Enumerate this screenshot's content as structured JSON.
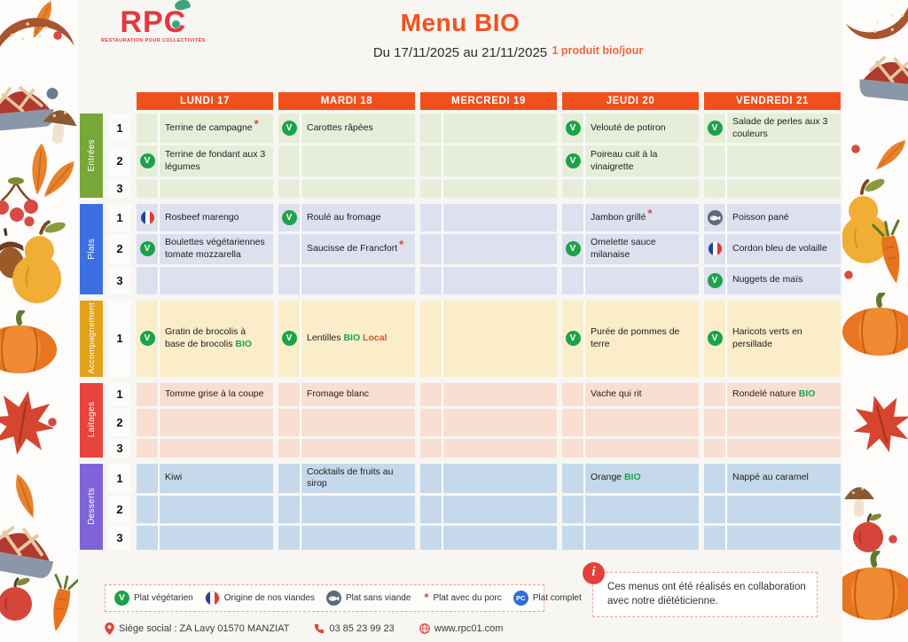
{
  "header": {
    "logo_text": "RPC",
    "logo_tagline": "RESTAURATION POUR COLLECTIVITÉS",
    "title": "Menu BIO",
    "date_range": "Du 17/11/2025 au 21/11/2025",
    "bio_note": "1 produit bio/jour"
  },
  "days": [
    "LUNDI 17",
    "MARDI 18",
    "MERCREDI 19",
    "JEUDI 20",
    "VENDREDI 21"
  ],
  "colors": {
    "day_header_orange": "#F1501D",
    "logo_red": "#E5383E",
    "bio_green": "#17A74F",
    "local_orange": "#C75A2B",
    "asterisk_red": "#E3403A"
  },
  "sections": [
    {
      "label": "Entrées",
      "label_color": "#76A737",
      "cell_color": "#E6EEDA",
      "rows": [
        {
          "num": "1",
          "cells": [
            {
              "icon": null,
              "asterisk": true,
              "segments": [
                [
                  "Terrine de campagne",
                  "plain"
                ]
              ]
            },
            {
              "icon": "veg",
              "segments": [
                [
                  "Carottes râpées",
                  "plain"
                ]
              ]
            },
            {
              "icon": null,
              "segments": []
            },
            {
              "icon": "veg",
              "segments": [
                [
                  "Velouté de potiron",
                  "plain"
                ]
              ]
            },
            {
              "icon": "veg",
              "segments": [
                [
                  "Salade de perles aux 3 couleurs",
                  "plain"
                ]
              ]
            }
          ]
        },
        {
          "num": "2",
          "cells": [
            {
              "icon": "veg",
              "segments": [
                [
                  "Terrine de fondant aux 3 légumes",
                  "plain"
                ]
              ]
            },
            {
              "icon": null,
              "segments": []
            },
            {
              "icon": null,
              "segments": []
            },
            {
              "icon": "veg",
              "segments": [
                [
                  "Poireau cuit à la vinaigrette",
                  "plain"
                ]
              ]
            },
            {
              "icon": null,
              "segments": []
            }
          ]
        },
        {
          "num": "3",
          "cells": [
            {
              "icon": null,
              "segments": []
            },
            {
              "icon": null,
              "segments": []
            },
            {
              "icon": null,
              "segments": []
            },
            {
              "icon": null,
              "segments": []
            },
            {
              "icon": null,
              "segments": []
            }
          ]
        }
      ]
    },
    {
      "label": "Plats",
      "label_color": "#3C70E2",
      "cell_color": "#DCE0EF",
      "rows": [
        {
          "num": "1",
          "cells": [
            {
              "icon": "flag",
              "segments": [
                [
                  "Rosbeef marengo",
                  "plain"
                ]
              ]
            },
            {
              "icon": "veg",
              "segments": [
                [
                  "Roulé au fromage",
                  "plain"
                ]
              ]
            },
            {
              "icon": null,
              "segments": []
            },
            {
              "icon": null,
              "asterisk": true,
              "segments": [
                [
                  "Jambon grillé",
                  "plain"
                ]
              ]
            },
            {
              "icon": "fish",
              "segments": [
                [
                  "Poisson pané",
                  "plain"
                ]
              ]
            }
          ]
        },
        {
          "num": "2",
          "cells": [
            {
              "icon": "veg",
              "segments": [
                [
                  "Boulettes végétariennes tomate mozzarella",
                  "plain"
                ]
              ]
            },
            {
              "icon": null,
              "asterisk": true,
              "segments": [
                [
                  "Saucisse de Francfort",
                  "plain"
                ]
              ]
            },
            {
              "icon": null,
              "segments": []
            },
            {
              "icon": "veg",
              "segments": [
                [
                  "Omelette sauce milanaise",
                  "plain"
                ]
              ]
            },
            {
              "icon": "flag",
              "segments": [
                [
                  "Cordon bleu de volaille",
                  "plain"
                ]
              ]
            }
          ]
        },
        {
          "num": "3",
          "cells": [
            {
              "icon": null,
              "segments": []
            },
            {
              "icon": null,
              "segments": []
            },
            {
              "icon": null,
              "segments": []
            },
            {
              "icon": null,
              "segments": []
            },
            {
              "icon": "veg",
              "segments": [
                [
                  "Nuggets de maïs",
                  "plain"
                ]
              ]
            }
          ]
        }
      ]
    },
    {
      "label": "Accompagnement",
      "label_color": "#E2A21A",
      "cell_color": "#FBEDCA",
      "rows": [
        {
          "num": "1",
          "cells": [
            {
              "icon": "veg",
              "segments": [
                [
                  "Gratin de brocolis à base de brocolis ",
                  "plain"
                ],
                [
                  "BIO",
                  "bio"
                ]
              ]
            },
            {
              "icon": "veg",
              "segments": [
                [
                  "Lentilles ",
                  "plain"
                ],
                [
                  "BIO",
                  "bio"
                ],
                [
                  " ",
                  "plain"
                ],
                [
                  "Local",
                  "local"
                ]
              ]
            },
            {
              "icon": null,
              "segments": []
            },
            {
              "icon": "veg",
              "segments": [
                [
                  "Purée de pommes de terre",
                  "plain"
                ]
              ]
            },
            {
              "icon": "veg",
              "segments": [
                [
                  "Haricots verts en persillade",
                  "plain"
                ]
              ]
            }
          ]
        }
      ]
    },
    {
      "label": "Laitages",
      "label_color": "#E8443C",
      "cell_color": "#F9DFD2",
      "rows": [
        {
          "num": "1",
          "cells": [
            {
              "icon": null,
              "segments": [
                [
                  "Tomme grise à la coupe",
                  "plain"
                ]
              ]
            },
            {
              "icon": null,
              "segments": [
                [
                  "Fromage blanc",
                  "plain"
                ]
              ]
            },
            {
              "icon": null,
              "segments": []
            },
            {
              "icon": null,
              "segments": [
                [
                  "Vache qui rit",
                  "plain"
                ]
              ]
            },
            {
              "icon": null,
              "segments": [
                [
                  "Rondelé nature ",
                  "plain"
                ],
                [
                  "BIO",
                  "bio"
                ]
              ]
            }
          ]
        },
        {
          "num": "2",
          "cells": [
            {
              "icon": null,
              "segments": []
            },
            {
              "icon": null,
              "segments": []
            },
            {
              "icon": null,
              "segments": []
            },
            {
              "icon": null,
              "segments": []
            },
            {
              "icon": null,
              "segments": []
            }
          ]
        },
        {
          "num": "3",
          "cells": [
            {
              "icon": null,
              "segments": []
            },
            {
              "icon": null,
              "segments": []
            },
            {
              "icon": null,
              "segments": []
            },
            {
              "icon": null,
              "segments": []
            },
            {
              "icon": null,
              "segments": []
            }
          ]
        }
      ]
    },
    {
      "label": "Desserts",
      "label_color": "#7F64D8",
      "cell_color": "#C5D9EB",
      "rows": [
        {
          "num": "1",
          "cells": [
            {
              "icon": null,
              "segments": [
                [
                  "Kiwi",
                  "plain"
                ]
              ]
            },
            {
              "icon": null,
              "segments": [
                [
                  "Cocktails de fruits au sirop",
                  "plain"
                ]
              ]
            },
            {
              "icon": null,
              "segments": []
            },
            {
              "icon": null,
              "segments": [
                [
                  "Orange ",
                  "plain"
                ],
                [
                  "BIO",
                  "bio"
                ]
              ]
            },
            {
              "icon": null,
              "segments": [
                [
                  "Nappé au caramel",
                  "plain"
                ]
              ]
            }
          ]
        },
        {
          "num": "2",
          "cells": [
            {
              "icon": null,
              "segments": []
            },
            {
              "icon": null,
              "segments": []
            },
            {
              "icon": null,
              "segments": []
            },
            {
              "icon": null,
              "segments": []
            },
            {
              "icon": null,
              "segments": []
            }
          ]
        },
        {
          "num": "3",
          "cells": [
            {
              "icon": null,
              "segments": []
            },
            {
              "icon": null,
              "segments": []
            },
            {
              "icon": null,
              "segments": []
            },
            {
              "icon": null,
              "segments": []
            },
            {
              "icon": null,
              "segments": []
            }
          ]
        }
      ]
    }
  ],
  "legend": [
    {
      "icon": "veg",
      "label": "Plat végétarien"
    },
    {
      "icon": "flag",
      "label": "Origine de nos viandes"
    },
    {
      "icon": "fish",
      "label": "Plat sans viande"
    },
    {
      "icon": "asterisk",
      "label": "Plat avec du porc"
    },
    {
      "icon": "pc",
      "label": "Plat complet"
    }
  ],
  "note": {
    "text": "Ces menus ont été réalisés en collaboration avec notre diététicienne."
  },
  "footer": {
    "address": "Siège social : ZA Lavy 01570 MANZIAT",
    "phone": "03 85 23 99 23",
    "website": "www.rpc01.com"
  },
  "decorations": {
    "left": [
      "leaf",
      "croissant",
      "berry",
      "pie",
      "grey_berry",
      "mushroom",
      "leaf",
      "leaf",
      "berries",
      "berry",
      "acorn",
      "pear",
      "pumpkin",
      "maple_leaf",
      "leaf",
      "berry",
      "pie",
      "apple",
      "carrot"
    ],
    "right": [
      "croissant",
      "pie",
      "berry",
      "leaf",
      "pear",
      "carrot",
      "berry",
      "pumpkin",
      "maple_leaf",
      "mushroom",
      "apple",
      "pumpkin",
      "berry"
    ]
  }
}
